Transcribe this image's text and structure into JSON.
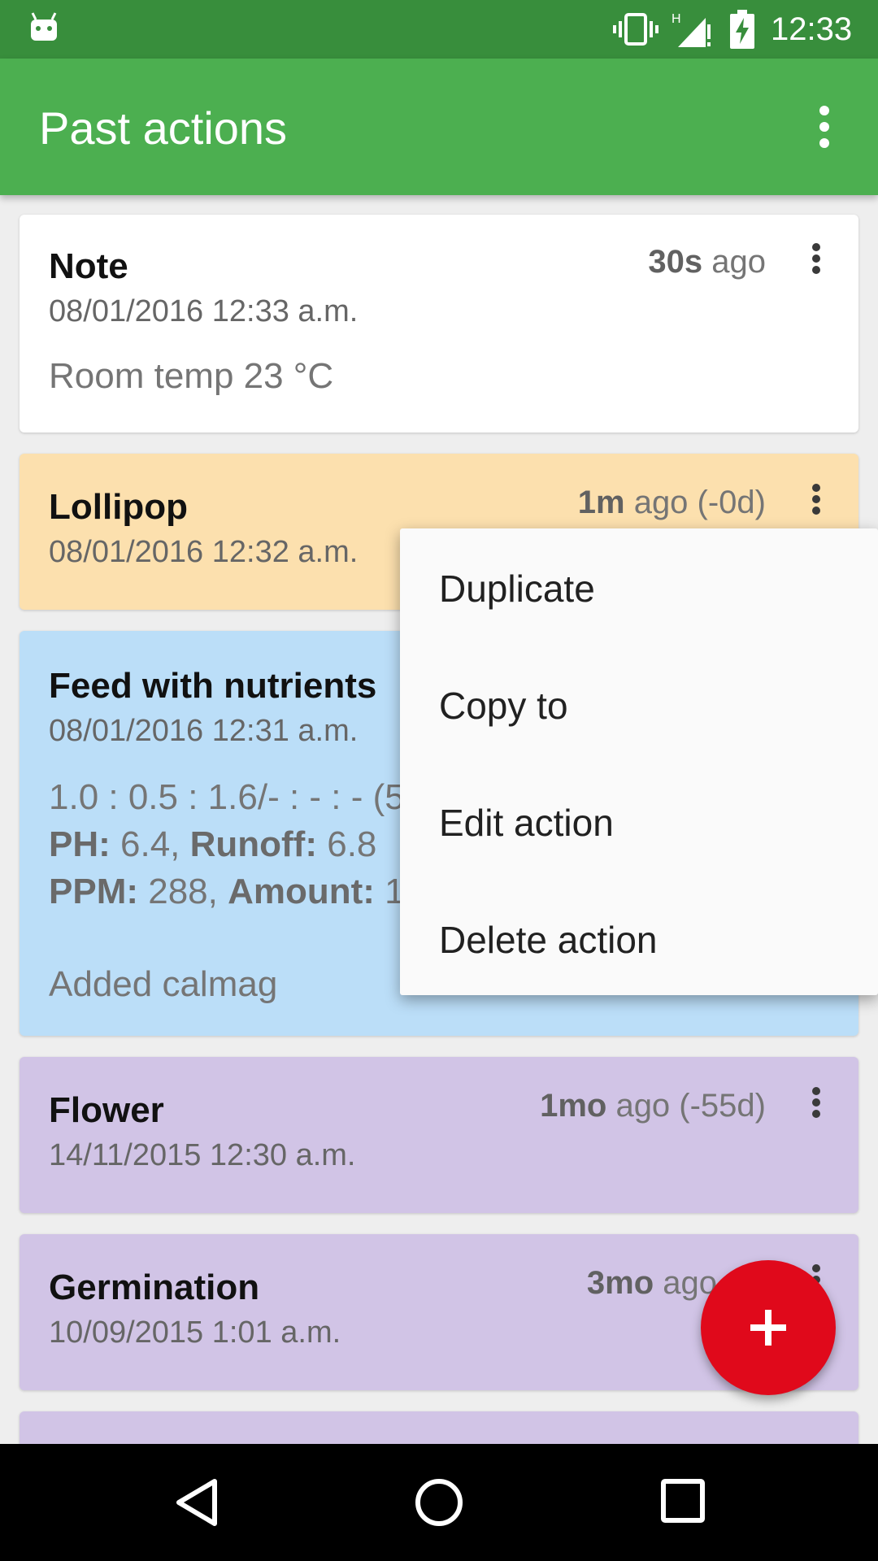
{
  "status_bar": {
    "time": "12:33"
  },
  "toolbar": {
    "title": "Past actions"
  },
  "actions": [
    {
      "title": "Note",
      "date": "08/01/2016 12:33 a.m.",
      "ago_value": "30s",
      "ago_text": " ago",
      "note": "Room temp 23 °C",
      "color": "#FFFFFF"
    },
    {
      "title": "Lollipop",
      "date": "08/01/2016 12:32 a.m.",
      "ago_value": "1m",
      "ago_text": " ago (-0d)",
      "color": "#FCE0AE"
    },
    {
      "title": "Feed with nutrients",
      "date": "08/01/2016 12:31 a.m.",
      "ratio": "1.0 : 0.5 : 1.6/- : - : - (5",
      "ph_label": "PH:",
      "ph_value": " 6.4, ",
      "runoff_label": "Runoff:",
      "runoff_value": " 6.8",
      "ppm_label": "PPM:",
      "ppm_value": " 288, ",
      "amount_label": "Amount:",
      "amount_value": " 1",
      "note": "Added calmag",
      "color": "#BBDEF8"
    },
    {
      "title": "Flower",
      "date": "14/11/2015 12:30 a.m.",
      "ago_value": "1mo",
      "ago_text": " ago (-55d)",
      "color": "#D1C4E6"
    },
    {
      "title": "Germination",
      "date": "10/09/2015 1:01 a.m.",
      "ago_value": "3mo",
      "ago_text": " ago (-6",
      "color": "#D1C4E6"
    }
  ],
  "popup_menu": {
    "items": [
      "Duplicate",
      "Copy to",
      "Edit action",
      "Delete action"
    ]
  },
  "fab": {
    "icon": "plus-icon",
    "color": "#E0091B"
  },
  "colors": {
    "primary": "#4CAF50",
    "primary_dark": "#388E3C"
  }
}
